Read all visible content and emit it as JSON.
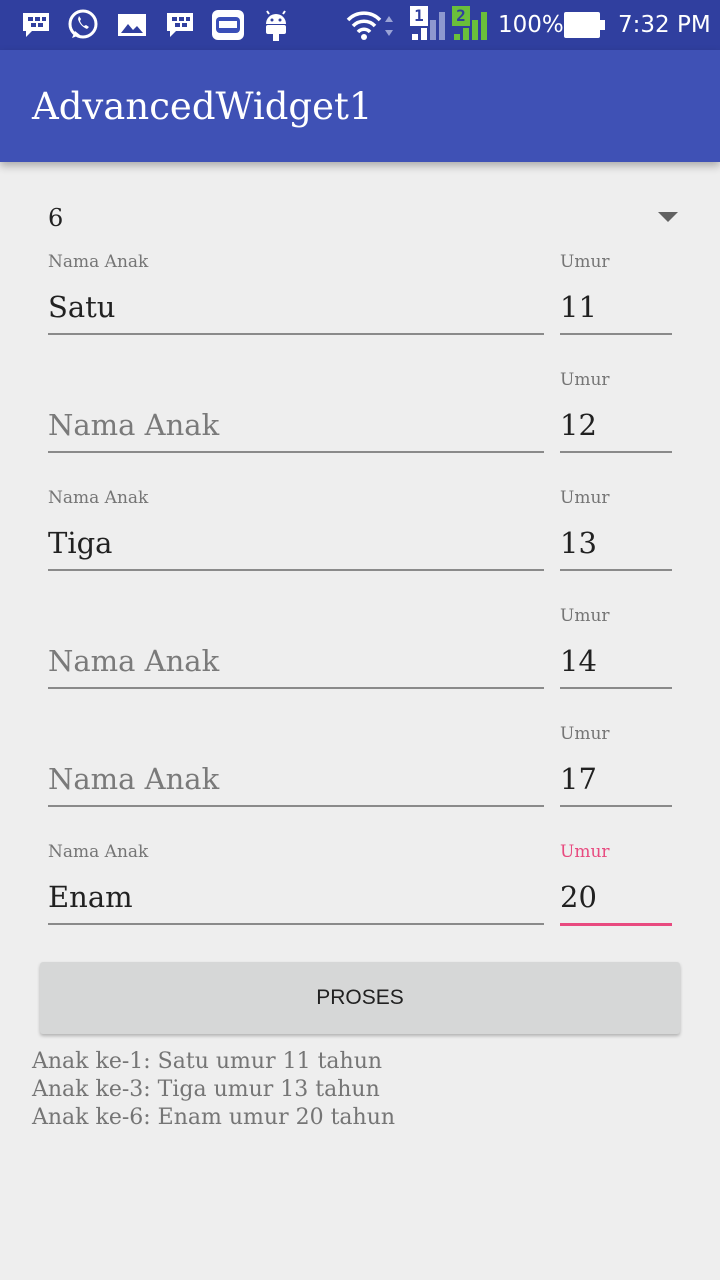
{
  "status_bar": {
    "battery": "100%",
    "time": "7:32 PM",
    "sim1": "1",
    "sim2": "2",
    "icons": [
      "bbm-icon",
      "whatsapp-icon",
      "gallery-icon",
      "bbm-icon",
      "game-icon",
      "android-icon",
      "wifi-icon",
      "signal-icon",
      "battery-icon"
    ]
  },
  "app": {
    "title": "AdvancedWidget1"
  },
  "spinner": {
    "value": "6"
  },
  "rows": [
    {
      "name_label": "Nama Anak",
      "name_value": "Satu",
      "name_hint": "Nama Anak",
      "age_label": "Umur",
      "age_value": "11"
    },
    {
      "name_label": "",
      "name_value": "",
      "name_hint": "Nama Anak",
      "age_label": "Umur",
      "age_value": "12"
    },
    {
      "name_label": "Nama Anak",
      "name_value": "Tiga",
      "name_hint": "Nama Anak",
      "age_label": "Umur",
      "age_value": "13"
    },
    {
      "name_label": "",
      "name_value": "",
      "name_hint": "Nama Anak",
      "age_label": "Umur",
      "age_value": "14"
    },
    {
      "name_label": "",
      "name_value": "",
      "name_hint": "Nama Anak",
      "age_label": "Umur",
      "age_value": "17"
    },
    {
      "name_label": "Nama Anak",
      "name_value": "Enam",
      "name_hint": "Nama Anak",
      "age_label": "Umur",
      "age_value": "20"
    }
  ],
  "button": {
    "label": "PROSES"
  },
  "result": [
    "Anak ke-1: Satu umur 11 tahun",
    "Anak ke-3: Tiga umur 13 tahun",
    "Anak ke-6: Enam umur 20 tahun"
  ],
  "colors": {
    "status_bar": "#303f9f",
    "app_bar": "#3f51b5",
    "accent": "#e84a7f",
    "background": "#eeeeee"
  }
}
